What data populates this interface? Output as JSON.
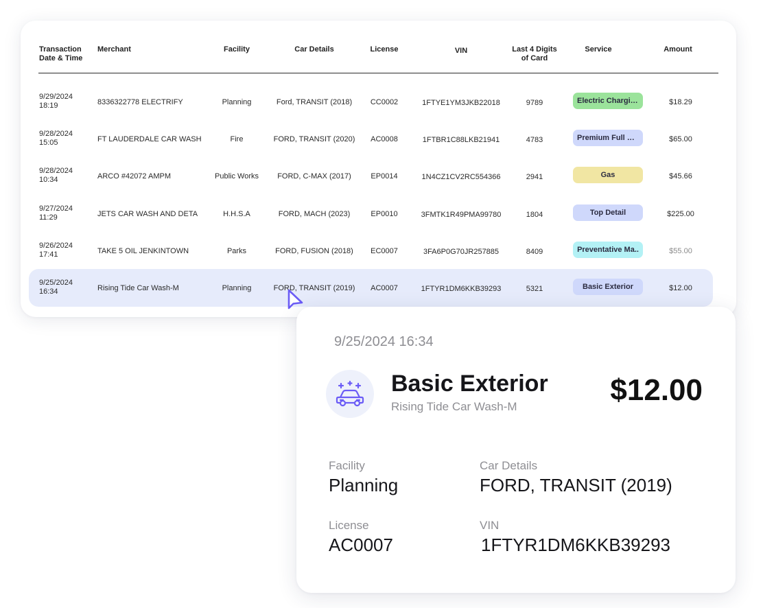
{
  "table": {
    "headers": {
      "date": "Transaction\nDate & Time",
      "merchant": "Merchant",
      "facility": "Facility",
      "car": "Car Details",
      "license": "License",
      "vin": "VIN",
      "last4": "Last 4 Digits\nof Card",
      "service": "Service",
      "amount": "Amount"
    },
    "rows": [
      {
        "date": "9/29/2024\n18:19",
        "merchant": "8336322778 ELECTRIFY",
        "facility": "Planning",
        "car": "Ford, TRANSIT (2018)",
        "license": "CC0002",
        "vin": "1FTYE1YM3JKB22018",
        "last4": "9789",
        "service": "Electric Charging",
        "service_color": "#9be39b",
        "amount": "$18.29"
      },
      {
        "date": "9/28/2024\n15:05",
        "merchant": "FT LAUDERDALE CAR WASH",
        "facility": "Fire",
        "car": "FORD, TRANSIT (2020)",
        "license": "AC0008",
        "vin": "1FTBR1C88LKB21941",
        "last4": "4783",
        "service": "Premium Full Ser..",
        "service_color": "#cfd8fb",
        "amount": "$65.00"
      },
      {
        "date": "9/28/2024\n10:34",
        "merchant": "ARCO #42072 AMPM",
        "facility": "Public Works",
        "car": "FORD, C-MAX (2017)",
        "license": "EP0014",
        "vin": "1N4CZ1CV2RC554366",
        "last4": "2941",
        "service": "Gas",
        "service_color": "#f1e6a3",
        "amount": "$45.66"
      },
      {
        "date": "9/27/2024\n11:29",
        "merchant": "JETS CAR WASH AND DETA",
        "facility": "H.H.S.A",
        "car": "FORD, MACH (2023)",
        "license": "EP0010",
        "vin": "3FMTK1R49PMA99780",
        "last4": "1804",
        "service": "Top Detail",
        "service_color": "#cfd8fb",
        "amount": "$225.00"
      },
      {
        "date": "9/26/2024\n17:41",
        "merchant": "TAKE 5 OIL JENKINTOWN",
        "facility": "Parks",
        "car": "FORD, FUSION (2018)",
        "license": "EC0007",
        "vin": "3FA6P0G70JR257885",
        "last4": "8409",
        "service": "Preventative Ma..",
        "service_color": "#b3f1f5",
        "amount": "$55.00"
      },
      {
        "date": "9/25/2024\n16:34",
        "merchant": "Rising Tide Car Wash-M",
        "facility": "Planning",
        "car": "FORD, TRANSIT (2019)",
        "license": "AC0007",
        "vin": "1FTYR1DM6KKB39293",
        "last4": "5321",
        "service": "Basic Exterior",
        "service_color": "#cfd8fb",
        "amount": "$12.00"
      }
    ]
  },
  "detail": {
    "datetime": "9/25/2024 16:34",
    "service": "Basic Exterior",
    "merchant": "Rising Tide Car Wash-M",
    "amount": "$12.00",
    "facility_label": "Facility",
    "facility": "Planning",
    "car_label": "Car Details",
    "car": "FORD, TRANSIT (2019)",
    "license_label": "License",
    "license": "AC0007",
    "vin_label": "VIN",
    "vin": "1FTYR1DM6KKB39293",
    "icon": "car-wash-icon"
  },
  "colors": {
    "accent": "#6b5cf6",
    "selected_row": "#e6ebfb"
  }
}
